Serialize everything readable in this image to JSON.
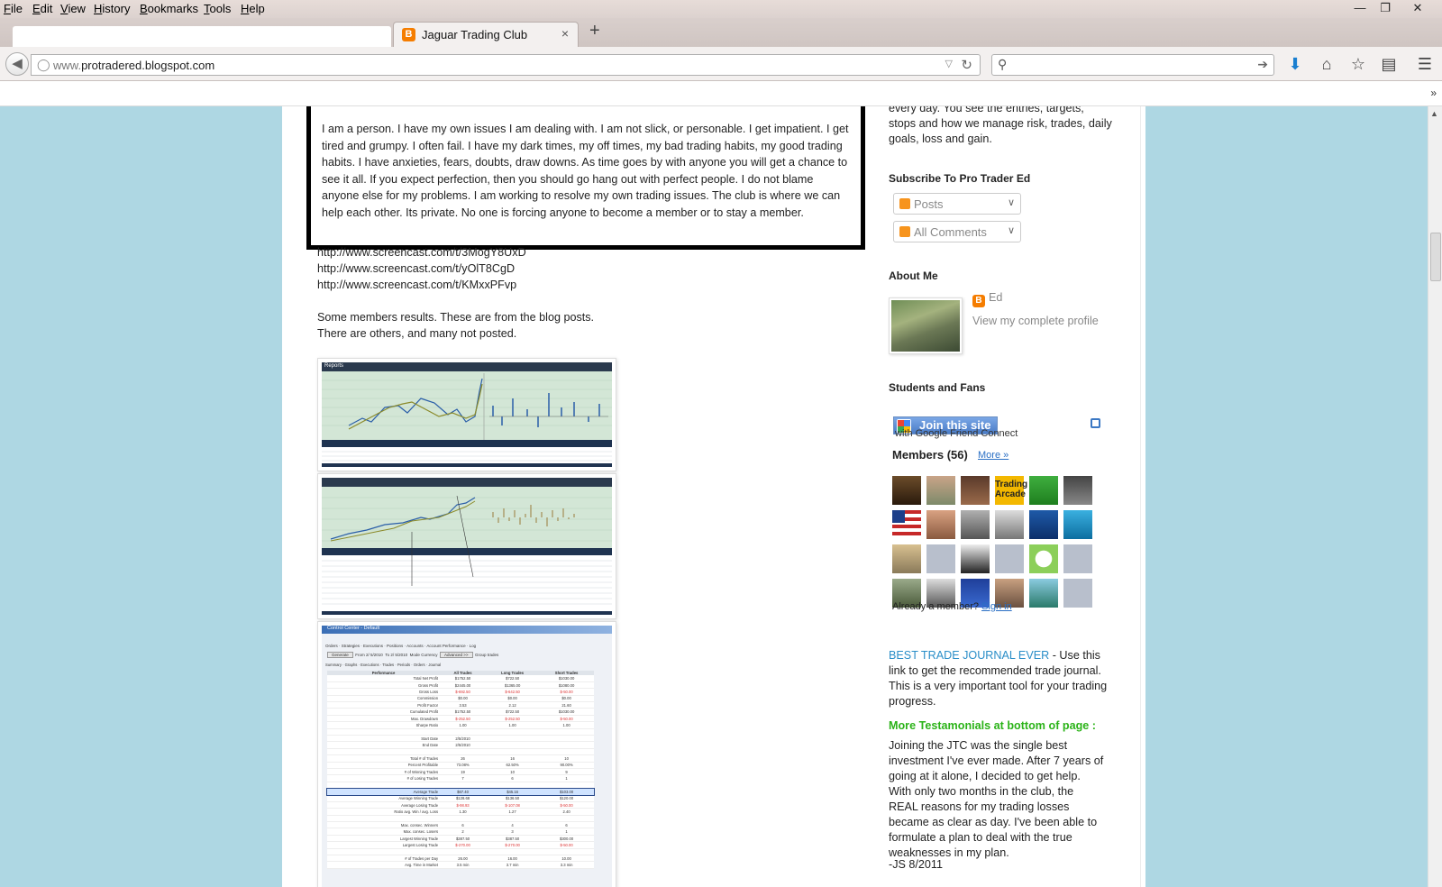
{
  "menubar": {
    "items": [
      {
        "label": "File",
        "key": "F",
        "rest": "ile"
      },
      {
        "label": "Edit",
        "key": "E",
        "rest": "dit"
      },
      {
        "label": "View",
        "key": "V",
        "rest": "iew"
      },
      {
        "label": "History",
        "key": "H",
        "rest": "istory"
      },
      {
        "label": "Bookmarks",
        "key": "B",
        "rest": "ookmarks"
      },
      {
        "label": "Tools",
        "key": "T",
        "rest": "ools"
      },
      {
        "label": "Help",
        "key": "H",
        "rest": "elp"
      }
    ]
  },
  "tab": {
    "title": "Jaguar Trading Club",
    "favicon_letter": "B",
    "close_glyph": "×",
    "new_glyph": "+"
  },
  "navbar": {
    "url_prefix": "www.",
    "url_rest": "protradered.blogspot.com",
    "search_placeholder": ""
  },
  "quote": {
    "text": "I am a person. I have my own issues I am dealing with. I am not slick, or personable. I get impatient. I get tired and grumpy. I often fail. I have my dark times, my off times, my bad trading habits, my good trading habits. I have anxieties, fears, doubts, draw downs. As time goes by with anyone you will get a chance to see it all.  If you expect perfection, then you should go hang out with perfect people. I do not blame anyone else for my problems. I am working to resolve my own trading issues. The club is where we can help each other. Its private. No one is forcing anyone to become a member or to stay a member."
  },
  "links": [
    "http://www.screencast.com/t/3MogY8UxD",
    "http://www.screencast.com/t/yOlT8CgD",
    "http://www.screencast.com/t/KMxxPFvp"
  ],
  "results_intro": {
    "line1": "Some members results. These are from the blog posts.",
    "line2": "There are others, and many not posted."
  },
  "screenshots": {
    "reports_label": "Reports",
    "control_center_label": "Control Center - Default",
    "panel_tabs": [
      "Orders",
      "Strategies",
      "Executions",
      "Positions",
      "Accounts",
      "Account Performance",
      "Log"
    ],
    "generate_label": "Generate",
    "from_label": "From",
    "to_label": "To",
    "date_from": "2/ 5/2010",
    "date_to": "2/ 5/2010",
    "mode_label": "Mode",
    "mode_value": "Currency",
    "advanced_label": "Advanced >>",
    "group_trades_label": "Group trades",
    "summary_tabs": [
      "Summary",
      "Graphs",
      "Executions",
      "Trades",
      "Periods",
      "Orders",
      "Journal"
    ],
    "table_headers": [
      "Performance",
      "All Trades",
      "Long Trades",
      "Short Trades"
    ],
    "table_rows": [
      [
        "Total Net Profit",
        "$1752.50",
        "$722.50",
        "$1030.00"
      ],
      [
        "Gross Profit",
        "$2445.00",
        "$1365.00",
        "$1080.00"
      ],
      [
        "Gross Loss",
        "$-692.50",
        "$-642.50",
        "$-50.00"
      ],
      [
        "Commission",
        "$0.00",
        "$0.00",
        "$0.00"
      ],
      [
        "Profit Factor",
        "3.53",
        "2.12",
        "21.60"
      ],
      [
        "Cumulated Profit",
        "$1752.50",
        "$722.50",
        "$1030.00"
      ],
      [
        "Max. Drawdown",
        "$-252.50",
        "$-252.50",
        "$-50.00"
      ],
      [
        "Sharpe Ratio",
        "1.00",
        "1.00",
        "1.00"
      ],
      [
        "",
        "",
        "",
        ""
      ],
      [
        "Start Date",
        "2/5/2010",
        "",
        ""
      ],
      [
        "End Date",
        "2/5/2010",
        "",
        ""
      ],
      [
        "",
        "",
        "",
        ""
      ],
      [
        "Total # of Trades",
        "26",
        "16",
        "10"
      ],
      [
        "Percent Profitable",
        "73.08%",
        "62.50%",
        "90.00%"
      ],
      [
        "# of Winning Trades",
        "19",
        "10",
        "9"
      ],
      [
        "# of Losing Trades",
        "7",
        "6",
        "1"
      ],
      [
        "",
        "",
        "",
        ""
      ],
      [
        "Average Trade",
        "$67.40",
        "$45.16",
        "$103.00"
      ],
      [
        "Average Winning Trade",
        "$128.68",
        "$136.50",
        "$120.00"
      ],
      [
        "Average Losing Trade",
        "$-98.93",
        "$-107.08",
        "$-50.00"
      ],
      [
        "Ratio avg. Win / avg. Loss",
        "1.30",
        "1.27",
        "2.40"
      ],
      [
        "",
        "",
        "",
        ""
      ],
      [
        "Max. consec. Winners",
        "6",
        "4",
        "6"
      ],
      [
        "Max. consec. Losers",
        "2",
        "3",
        "1"
      ],
      [
        "Largest Winning Trade",
        "$387.50",
        "$387.50",
        "$300.00"
      ],
      [
        "Largest Losing Trade",
        "$-270.00",
        "$-270.00",
        "$-50.00"
      ],
      [
        "",
        "",
        "",
        ""
      ],
      [
        "# of Trades per Day",
        "26.00",
        "16.00",
        "10.00"
      ],
      [
        "Avg. Time in Market",
        "3.5 min",
        "3.7 min",
        "3.3 min"
      ]
    ]
  },
  "sidebar": {
    "top_text": "every day. You see the entries, targets, stops and how we manage risk, trades, daily goals, loss and gain.",
    "subscribe_heading": "Subscribe To Pro Trader Ed",
    "subscribe_options": [
      "Posts",
      "All Comments"
    ],
    "about_heading": "About Me",
    "profile_name": "Ed",
    "profile_link": "View my complete profile",
    "fans_heading": "Students and Fans",
    "join_button": "Join this site",
    "join_sub": "with Google Friend Connect",
    "members_label": "Members (56)",
    "more_link": "More »",
    "already_member": "Already a member?",
    "sign_in": "Sign in",
    "journal_link": "BEST TRADE JOURNAL EVER",
    "journal_text": " - Use this link to get the recommended trade journal. This is a very important tool for your trading progress.",
    "testimonials_heading": "More Testamonials at bottom of page :",
    "testimonial": "Joining the JTC was the single best investment I've ever made. After 7 years of going at it alone, I decided to get help. With only two months in the club, the REAL reasons for my trading losses became as clear as day. I've been able to formulate a plan to deal with the true weaknesses in my plan.",
    "testimonial_sig": "-JS 8/2011",
    "trading_arcade_tile": "Trading Arcade"
  },
  "colors": {
    "page_bg": "#aed7e3",
    "link": "#2a8ec8",
    "green_heading": "#2bb318",
    "blogger_orange": "#f57d00"
  }
}
